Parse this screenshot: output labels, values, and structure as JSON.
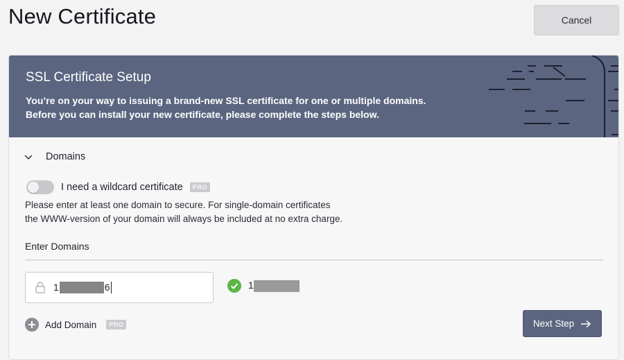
{
  "page": {
    "title": "New Certificate",
    "cancel_label": "Cancel"
  },
  "banner": {
    "title": "SSL Certificate Setup",
    "desc_line1": "You’re on your way to issuing a brand-new SSL certificate for one or multiple domains.",
    "desc_line2": "Before you can install your new certificate, please complete the steps below."
  },
  "domains_section": {
    "label": "Domains",
    "wildcard": {
      "label": "I need a wildcard certificate",
      "badge": "PRO",
      "enabled": false
    },
    "help_line1": "Please enter at least one domain to secure. For single-domain certificates",
    "help_line2": "the WWW-version of your domain will always be included at no extra charge.",
    "enter_label": "Enter Domains",
    "input": {
      "prefix": "1",
      "suffix": "6"
    },
    "validated": {
      "prefix": "1"
    },
    "add_label": "Add Domain",
    "add_badge": "PRO",
    "next_label": "Next Step"
  },
  "icons": {
    "chevron": "chevron-down-icon",
    "lock": "lock-icon",
    "check": "check-circle-icon",
    "plus": "plus-circle-icon",
    "arrow": "arrow-right-icon"
  },
  "colors": {
    "banner": "#5b6580",
    "success": "#5cb646",
    "button": "#5b6580"
  }
}
